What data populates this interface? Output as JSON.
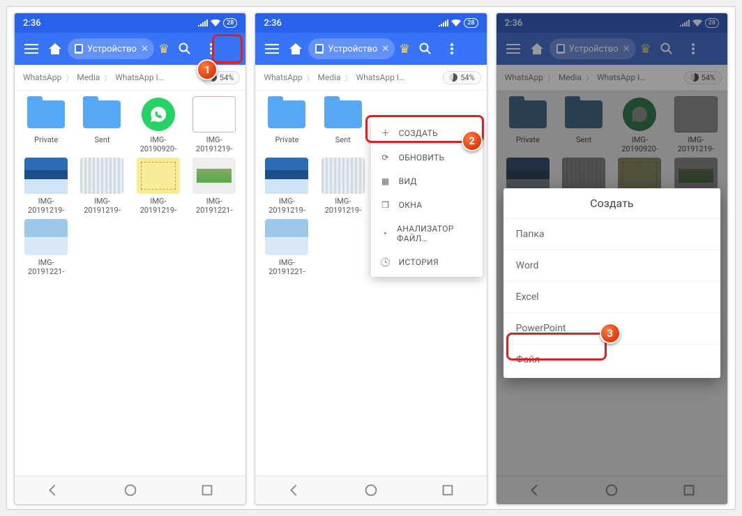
{
  "status": {
    "time": "2:36",
    "battery": "28"
  },
  "appbar": {
    "location": "Устройство"
  },
  "breadcrumb": {
    "a": "WhatsApp",
    "b": "Media",
    "c": "WhatsApp I…",
    "storage": "54%"
  },
  "files": {
    "f0": "Private",
    "f1": "Sent",
    "f2": "IMG-20190920-",
    "f3": "IMG-20191219-",
    "f4": "IMG-20191219-",
    "f5": "IMG-20191219-",
    "f6": "IMG-20191219-",
    "f7": "IMG-20191221-",
    "f8": "IMG-20191221-"
  },
  "menu": {
    "create": "СОЗДАТЬ",
    "refresh": "ОБНОВИТЬ",
    "view": "ВИД",
    "windows": "ОКНА",
    "analyzer": "АНАЛИЗАТОР ФАЙЛ…",
    "history": "ИСТОРИЯ"
  },
  "sheet": {
    "title": "Создать",
    "folder": "Папка",
    "word": "Word",
    "excel": "Excel",
    "powerpoint": "PowerPoint",
    "file": "Файл"
  },
  "badges": {
    "b1": "1",
    "b2": "2",
    "b3": "3"
  }
}
